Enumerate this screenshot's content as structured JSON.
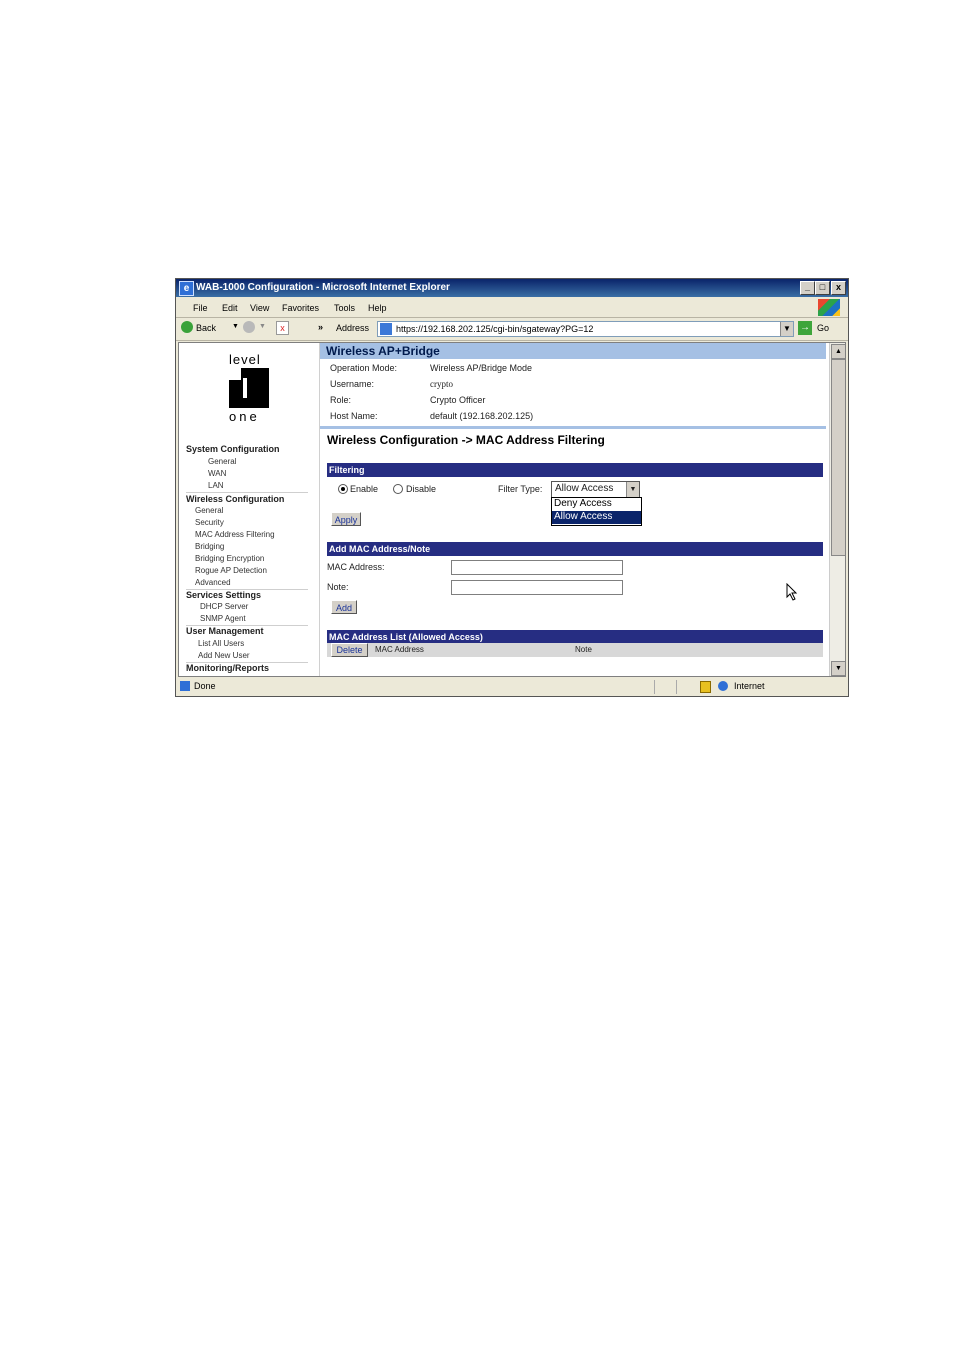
{
  "window": {
    "title": "WAB-1000 Configuration - Microsoft Internet Explorer",
    "min": "_",
    "max": "□",
    "close": "x"
  },
  "menu": [
    "File",
    "Edit",
    "View",
    "Favorites",
    "Tools",
    "Help"
  ],
  "toolbar": {
    "back": "Back",
    "chevron": "»",
    "address_label": "Address",
    "url": "https://192.168.202.125/cgi-bin/sgateway?PG=12",
    "go": "Go"
  },
  "logo": {
    "top": "level",
    "bottom": "one"
  },
  "nav": {
    "system_configuration": "System Configuration",
    "sys_items": [
      "General",
      "WAN",
      "LAN"
    ],
    "wireless_configuration": "Wireless Configuration",
    "wl_items": [
      "General",
      "Security",
      "MAC Address Filtering",
      "Bridging",
      "Bridging Encryption",
      "Rogue AP Detection",
      "Advanced"
    ],
    "services_settings": "Services Settings",
    "svc_items": [
      "DHCP Server",
      "SNMP Agent"
    ],
    "user_management": "User Management",
    "user_items": [
      "List All Users",
      "Add New User"
    ],
    "monitoring": "Monitoring/Reports"
  },
  "header": {
    "title": "Wireless AP+Bridge",
    "operation_mode_label": "Operation Mode:",
    "operation_mode_value": "Wireless AP/Bridge Mode",
    "username_label": "Username:",
    "username_value": "crypto",
    "role_label": "Role:",
    "role_value": "Crypto Officer",
    "host_label": "Host Name:",
    "host_value": "default (192.168.202.125)"
  },
  "page_title": "Wireless Configuration -> MAC Address Filtering",
  "filtering": {
    "band": "Filtering",
    "enable": "Enable",
    "disable": "Disable",
    "filter_type_label": "Filter Type:",
    "selected": "Allow Access",
    "options": [
      "Deny Access",
      "Allow Access"
    ],
    "apply": "Apply"
  },
  "add_mac": {
    "band": "Add MAC Address/Note",
    "mac_label": "MAC Address:",
    "note_label": "Note:",
    "add": "Add"
  },
  "mac_list": {
    "band": "MAC Address List (Allowed Access)",
    "delete": "Delete",
    "col_mac": "MAC Address",
    "col_note": "Note"
  },
  "status": {
    "text": "Done",
    "zone": "Internet"
  }
}
